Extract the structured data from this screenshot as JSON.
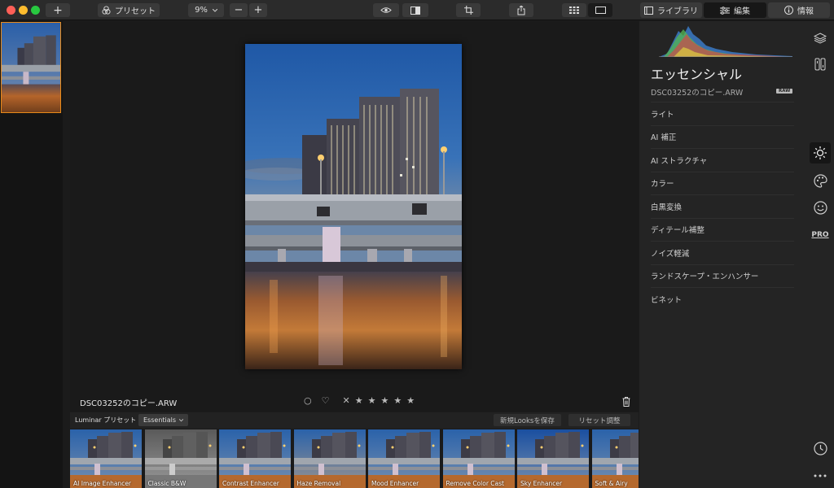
{
  "toolbar": {
    "add_label": "+",
    "presets_label": "プリセット",
    "zoom_value": "9%",
    "zoom_minus": "−",
    "zoom_plus": "+",
    "library_tab": "ライブラリ",
    "edit_tab": "編集",
    "info_tab": "情報"
  },
  "image": {
    "filename": "DSC03252のコピー.ARW"
  },
  "rating": {
    "stars": 5,
    "star_glyph": "★",
    "reject_glyph": "✕",
    "flag_glyph": "○",
    "heart_glyph": "♡"
  },
  "presets": {
    "header_label": "Luminar プリセット",
    "selected_category": "Essentials",
    "save_looks_label": "新規Looksを保存",
    "reset_label": "リセット調整",
    "items": [
      {
        "name": "AI Image Enhancer"
      },
      {
        "name": "Classic B&W"
      },
      {
        "name": "Contrast Enhancer"
      },
      {
        "name": "Haze Removal"
      },
      {
        "name": "Mood Enhancer"
      },
      {
        "name": "Remove Color Cast"
      },
      {
        "name": "Sky Enhancer"
      },
      {
        "name": "Soft & Airy"
      }
    ]
  },
  "panel": {
    "title": "エッセンシャル",
    "filename": "DSC03252のコピー.ARW",
    "raw_badge": "RAW",
    "tools": [
      {
        "label": "ライト"
      },
      {
        "label": "AI 補正"
      },
      {
        "label": "AI ストラクチャ"
      },
      {
        "label": "カラー"
      },
      {
        "label": "白黒変換"
      },
      {
        "label": "ディテール補整"
      },
      {
        "label": "ノイズ軽減"
      },
      {
        "label": "ランドスケープ・エンハンサー"
      },
      {
        "label": "ビネット"
      }
    ]
  },
  "sidebar": {
    "pro_label": "PRO"
  },
  "colors": {
    "accent_orange": "#e88a1a",
    "window_red": "#ff5f57",
    "window_yellow": "#febc2e",
    "window_green": "#28c840"
  }
}
